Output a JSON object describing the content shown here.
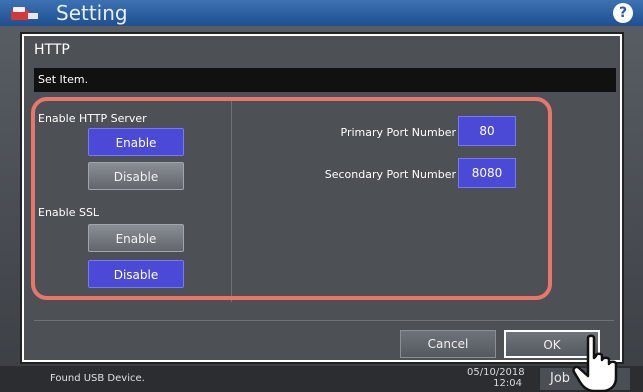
{
  "header": {
    "title": "Setting",
    "help_label": "?"
  },
  "dialog": {
    "title": "HTTP",
    "subheading": "Set Item.",
    "http_server": {
      "label": "Enable HTTP Server",
      "enable_label": "Enable",
      "disable_label": "Disable",
      "selected": "Enable"
    },
    "ssl": {
      "label": "Enable SSL",
      "enable_label": "Enable",
      "disable_label": "Disable",
      "selected": "Disable"
    },
    "ports": {
      "primary_label": "Primary Port Number",
      "primary_value": "80",
      "secondary_label": "Secondary Port Number",
      "secondary_value": "8080"
    },
    "cancel_label": "Cancel",
    "ok_label": "OK"
  },
  "status_bar": {
    "message": "Found USB Device.",
    "date": "05/10/2018",
    "time": "12:04",
    "job_label": "Job"
  },
  "colors": {
    "selected_button": "#4a4ad6",
    "highlight_outline": "#e8766a",
    "dialog_bg": "#4d5156"
  }
}
